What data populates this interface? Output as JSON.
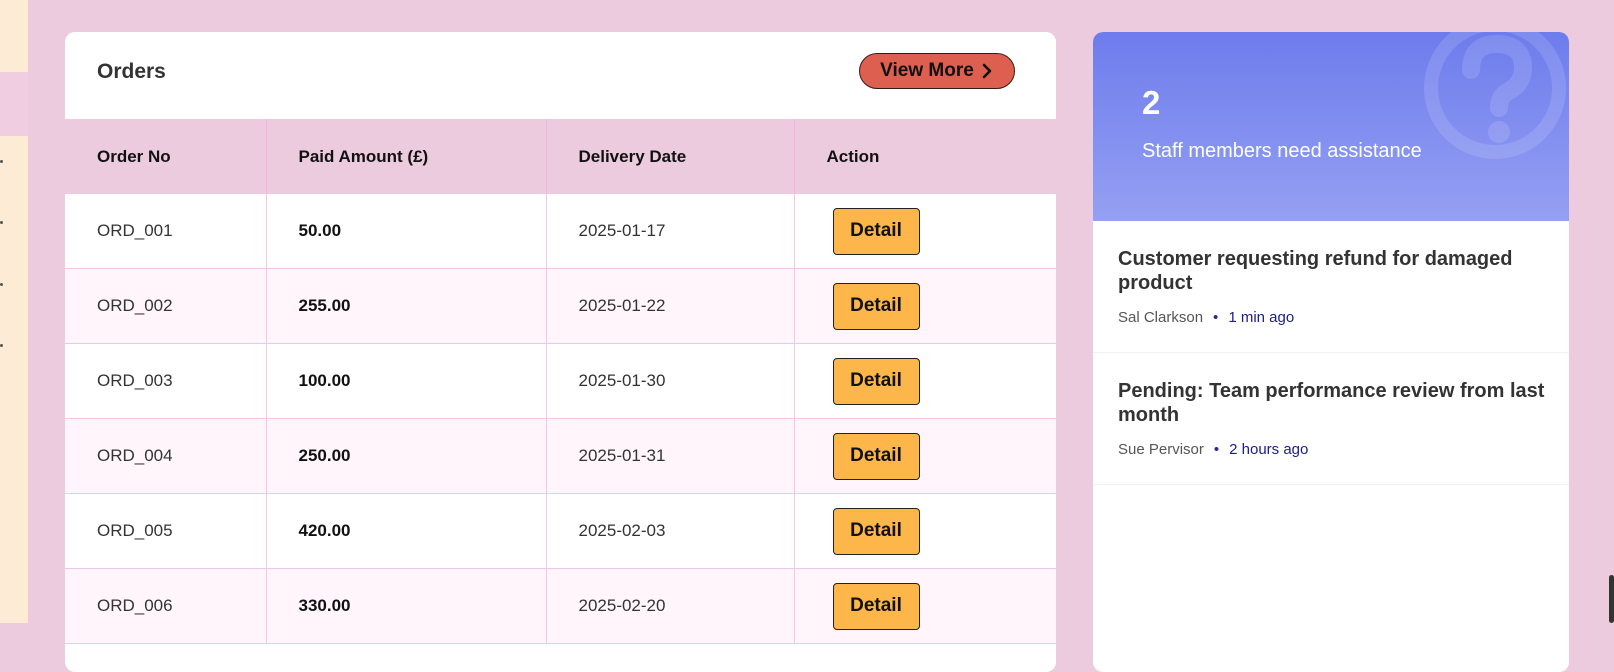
{
  "orders": {
    "title": "Orders",
    "view_more_label": "View More",
    "columns": [
      "Order No",
      "Paid Amount (£)",
      "Delivery Date",
      "Action"
    ],
    "rows": [
      {
        "order_no": "ORD_001",
        "amount": "50.00",
        "date": "2025-01-17",
        "action": "Detail"
      },
      {
        "order_no": "ORD_002",
        "amount": "255.00",
        "date": "2025-01-22",
        "action": "Detail"
      },
      {
        "order_no": "ORD_003",
        "amount": "100.00",
        "date": "2025-01-30",
        "action": "Detail"
      },
      {
        "order_no": "ORD_004",
        "amount": "250.00",
        "date": "2025-01-31",
        "action": "Detail"
      },
      {
        "order_no": "ORD_005",
        "amount": "420.00",
        "date": "2025-02-03",
        "action": "Detail"
      },
      {
        "order_no": "ORD_006",
        "amount": "330.00",
        "date": "2025-02-20",
        "action": "Detail"
      }
    ]
  },
  "assistance": {
    "count": "2",
    "text": "Staff members need assistance",
    "icon": "help-circle-icon",
    "items": [
      {
        "title": "Customer requesting refund for damaged product",
        "author": "Sal Clarkson",
        "separator": "•",
        "time": "1 min ago"
      },
      {
        "title": "Pending: Team performance review from last month",
        "author": "Sue Pervisor",
        "separator": "•",
        "time": "2 hours ago"
      }
    ]
  },
  "colors": {
    "page_bg": "#eccbde",
    "view_more_bg": "#dc5f4f",
    "detail_bg": "#fdb64a",
    "assist_gradient_top": "#6d7cec",
    "assist_gradient_bottom": "#95a0f3"
  }
}
